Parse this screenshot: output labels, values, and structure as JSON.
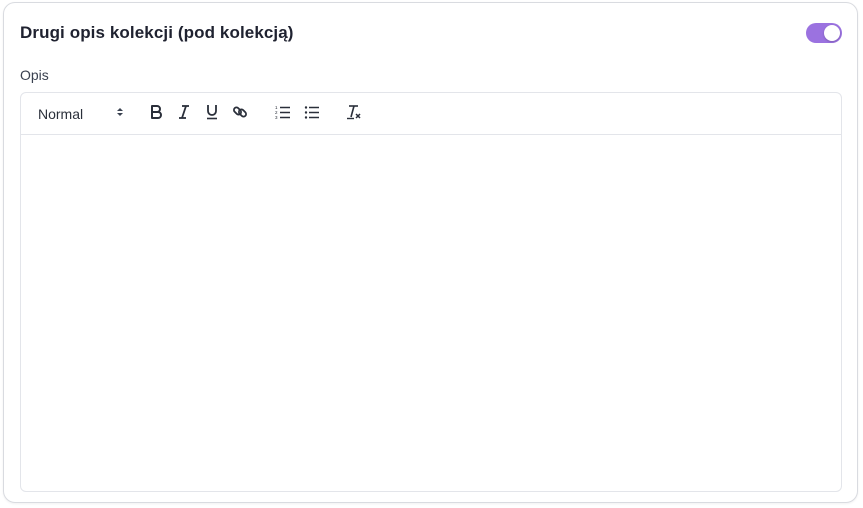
{
  "section": {
    "title": "Drugi opis kolekcji (pod kolekcją)",
    "toggle_on": true,
    "accent_color": "#9b72e0"
  },
  "field": {
    "label": "Opis",
    "content": ""
  },
  "toolbar": {
    "format_select": {
      "value": "Normal",
      "icon": "up-down-chevron-icon"
    },
    "buttons": [
      {
        "name": "bold",
        "icon": "bold-icon"
      },
      {
        "name": "italic",
        "icon": "italic-icon"
      },
      {
        "name": "underline",
        "icon": "underline-icon"
      },
      {
        "name": "link",
        "icon": "link-icon"
      },
      {
        "name": "ordered-list",
        "icon": "ordered-list-icon"
      },
      {
        "name": "bullet-list",
        "icon": "bullet-list-icon"
      },
      {
        "name": "clear-formatting",
        "icon": "clear-formatting-icon"
      }
    ]
  }
}
